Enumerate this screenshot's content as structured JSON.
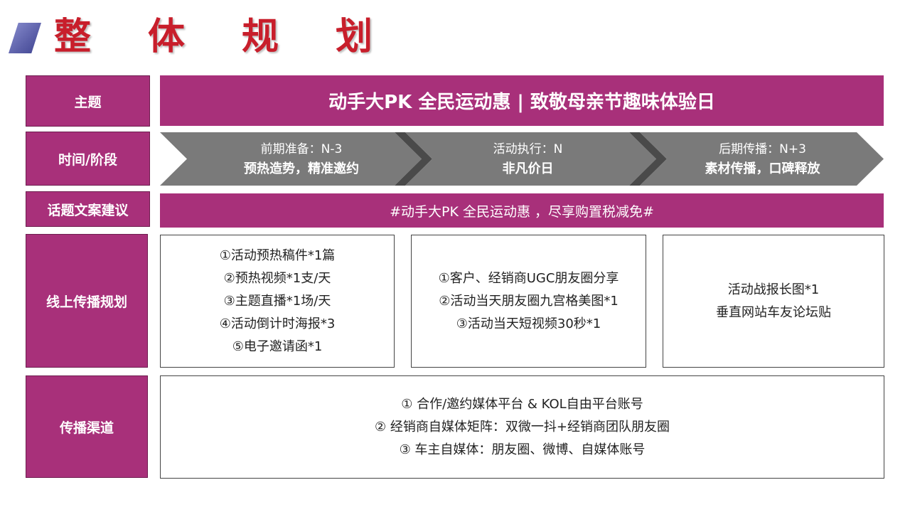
{
  "page": {
    "title": "整体规划"
  },
  "rows": {
    "theme_label": "主题",
    "time_label": "时间/阶段",
    "topic_label": "话题文案建议",
    "online_label": "线上传播规划",
    "channel_label": "传播渠道"
  },
  "theme": "动手大PK  全民运动惠  |  致敬母亲节趣味体验日",
  "stages": [
    {
      "name": "前期准备：N-3",
      "desc": "预热造势，精准邀约"
    },
    {
      "name": "活动执行：N",
      "desc": "非凡价日"
    },
    {
      "name": "后期传播：N+3",
      "desc": "素材传播，口碑释放"
    }
  ],
  "topic": "#动手大PK  全民运动惠 ，尽享购置税减免#",
  "online_plan": [
    {
      "lines": [
        "①活动预热稿件*1篇",
        "②预热视频*1支/天",
        "③主题直播*1场/天",
        "④活动倒计时海报*3",
        "⑤电子邀请函*1"
      ]
    },
    {
      "lines": [
        "①客户、经销商UGC朋友圈分享",
        "②活动当天朋友圈九宫格美图*1",
        "③活动当天短视频30秒*1"
      ]
    },
    {
      "lines": [
        "活动战报长图*1",
        "垂直网站车友论坛贴"
      ]
    }
  ],
  "channels": [
    "① 合作/邀约媒体平台 & KOL自由平台账号",
    "② 经销商自媒体矩阵：双微一抖+经销商团队朋友圈",
    "③ 车主自媒体：朋友圈、微博、自媒体账号"
  ],
  "colors": {
    "accent": "#a8307a",
    "title": "#c81e2b",
    "arrow": "#7a7a7a",
    "arrow_edge": "#4a4a4a"
  }
}
